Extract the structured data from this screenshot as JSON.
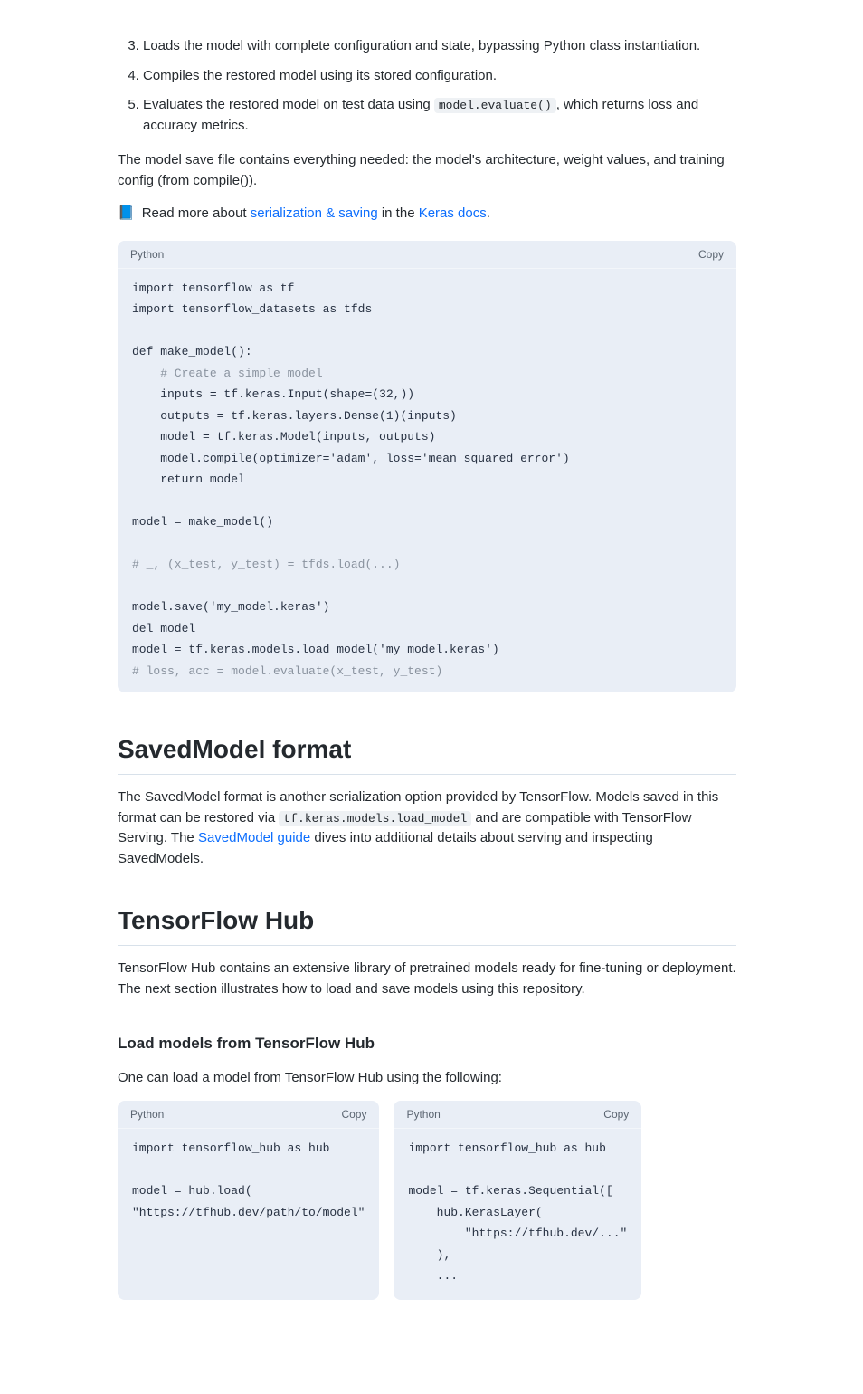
{
  "intro_steps": {
    "step3": "Loads the model with complete configuration and state, bypassing Python class instantiation.",
    "step4": "Compiles the restored model using its stored configuration.",
    "step5_pre": "Evaluates the restored model on test data using ",
    "step5_code": "model.evaluate()",
    "step5_post": ", which returns loss and accuracy metrics."
  },
  "para_after_steps": "The model save file contains everything needed: the model's architecture, weight values, and training config (from compile()).",
  "note": {
    "emoji": "📘",
    "text_pre": "Read more about ",
    "link1": "serialization & saving",
    "mid": " in the ",
    "link2": "Keras docs",
    "post": "."
  },
  "code_loading": {
    "lang": "Python",
    "copy": "Copy",
    "lines": [
      {
        "t": "plain",
        "v": "import tensorflow as tf"
      },
      {
        "t": "plain",
        "v": "import tensorflow_datasets as tfds"
      },
      {
        "t": "blank",
        "v": ""
      },
      {
        "t": "func",
        "v": "def make_model():"
      },
      {
        "t": "comment",
        "v": "    # Create a simple model"
      },
      {
        "t": "plain",
        "v": "    inputs = tf.keras.Input(shape=(32,))"
      },
      {
        "t": "plain",
        "v": "    outputs = tf.keras.layers.Dense(1)(inputs)"
      },
      {
        "t": "plain",
        "v": "    model = tf.keras.Model(inputs, outputs)"
      },
      {
        "t": "plain",
        "v": "    model.compile(optimizer='adam', loss='mean_squared_error')"
      },
      {
        "t": "plain",
        "v": "    return model"
      },
      {
        "t": "blank",
        "v": ""
      },
      {
        "t": "plain",
        "v": "model = make_model()"
      },
      {
        "t": "blank",
        "v": ""
      },
      {
        "t": "comment",
        "v": "# _, (x_test, y_test) = tfds.load(...)"
      },
      {
        "t": "blank",
        "v": ""
      },
      {
        "t": "plain",
        "v": "model.save('my_model.keras')"
      },
      {
        "t": "plain",
        "v": "del model"
      },
      {
        "t": "plain",
        "v": "model = tf.keras.models.load_model('my_model.keras')"
      },
      {
        "t": "comment",
        "v": "# loss, acc = model.evaluate(x_test, y_test)"
      }
    ]
  },
  "sections": {
    "saved_model": {
      "title": "SavedModel format",
      "p1_pre": "The SavedModel format is another serialization option provided by TensorFlow. Models saved in this format can be restored via ",
      "p1_code": "tf.keras.models.load_model",
      "p1_mid": " and are compatible with TensorFlow Serving. The ",
      "p1_link": "SavedModel guide",
      "p1_post": " dives into additional details about serving and inspecting SavedModels."
    },
    "tf_hub": {
      "title": "TensorFlow Hub",
      "p1": "TensorFlow Hub contains an extensive library of pretrained models ready for fine-tuning or deployment. The next section illustrates how to load and save models using this repository.",
      "h3": "Load models from TensorFlow Hub",
      "p2": "One can load a model from TensorFlow Hub using the following:"
    }
  },
  "twocol_left": {
    "lang": "Python",
    "copy": "Copy",
    "lines": [
      "import tensorflow_hub as hub",
      "",
      "model = hub.load(",
      "\"https://tfhub.dev/path/to/model\""
    ]
  },
  "twocol_right": {
    "lang": "Python",
    "copy": "Copy",
    "lines": [
      "import tensorflow_hub as hub",
      "",
      "model = tf.keras.Sequential([",
      "    hub.KerasLayer(",
      "        \"https://tfhub.dev/...\"",
      "    ),",
      "    ..."
    ]
  }
}
